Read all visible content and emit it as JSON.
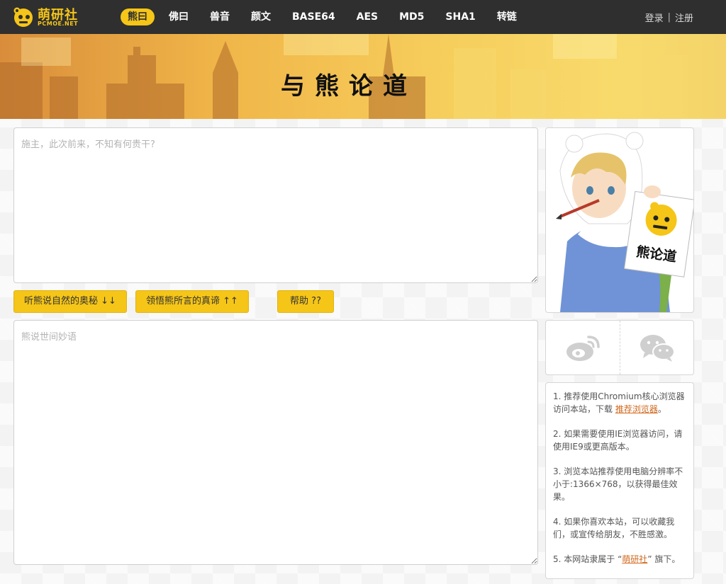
{
  "brand": {
    "name": "萌研社",
    "domain": "PCMOE.NET"
  },
  "nav": {
    "items": [
      {
        "label": "熊曰",
        "active": true
      },
      {
        "label": "佛曰",
        "active": false
      },
      {
        "label": "兽音",
        "active": false
      },
      {
        "label": "颜文",
        "active": false
      },
      {
        "label": "BASE64",
        "active": false
      },
      {
        "label": "AES",
        "active": false
      },
      {
        "label": "MD5",
        "active": false
      },
      {
        "label": "SHA1",
        "active": false
      },
      {
        "label": "转链",
        "active": false
      }
    ],
    "login": "登录",
    "separator": "|",
    "register": "注册"
  },
  "banner": {
    "title": "与熊论道"
  },
  "input": {
    "placeholder": "施主，此次前来，不知有何贵干?",
    "value": ""
  },
  "buttons": {
    "encode": "听熊说自然的奥秘 ↓↓",
    "decode": "领悟熊所言的真谛 ↑↑",
    "help": "帮助 ??"
  },
  "output": {
    "placeholder": "熊说世间妙语",
    "value": ""
  },
  "mascot": {
    "sign_text": "熊论道"
  },
  "share": {
    "left_icon": "weibo-icon",
    "right_icon": "wechat-icon"
  },
  "tips": {
    "tip1_before": "1. 推荐使用Chromium核心浏览器访问本站，下载 ",
    "tip1_link": "推荐浏览器",
    "tip1_after": "。",
    "tip2": "2. 如果需要使用IE浏览器访问，请使用IE9或更高版本。",
    "tip3": "3. 浏览本站推荐使用电脑分辨率不小于:1366×768，以获得最佳效果。",
    "tip4": "4. 如果你喜欢本站，可以收藏我们，或宣传给朋友，不胜感激。",
    "tip5_before": "5. 本网站隶属于 “",
    "tip5_link": "萌研社",
    "tip5_after": "” 旗下。"
  },
  "colors": {
    "topbar": "#2f2f2f",
    "accent": "#f5c518",
    "link": "#d2691e"
  }
}
